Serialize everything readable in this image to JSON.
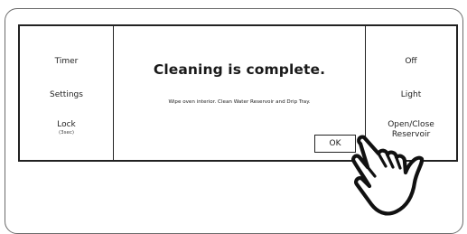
{
  "left_panel": {
    "timer_label": "Timer",
    "settings_label": "Settings",
    "lock_label": "Lock",
    "lock_sub": "(3sec)"
  },
  "dialog": {
    "title": "Cleaning is complete.",
    "message": "Wipe oven interior. Clean Water Reservoir and Drip Tray.",
    "ok_label": "OK"
  },
  "right_panel": {
    "off_label": "Off",
    "light_label": "Light",
    "reservoir_label_line1": "Open/Close",
    "reservoir_label_line2": "Reservoir"
  },
  "icons": {
    "pointer": "hand-pointer-icon"
  }
}
